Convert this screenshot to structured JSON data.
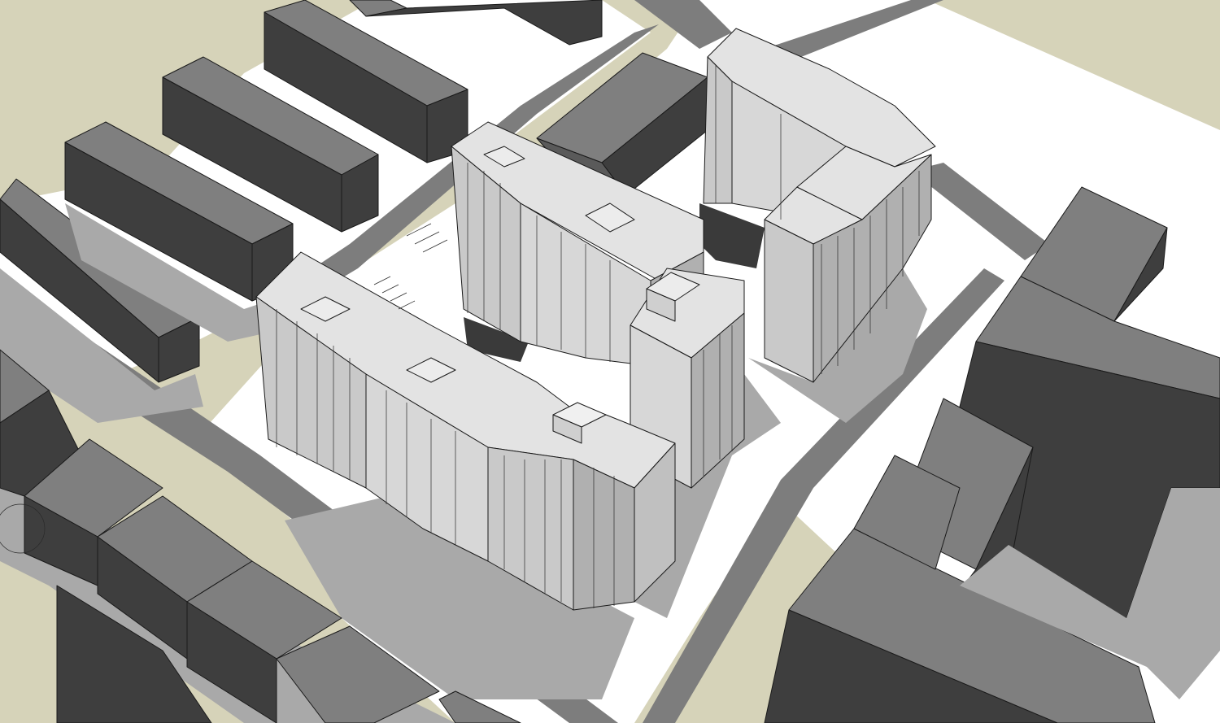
{
  "scene": {
    "description_tag": "massing-model",
    "colors": {
      "ground": "#d6d3b9",
      "site_white": "#ffffff",
      "road": "#7d7d7d",
      "shadow": "#a9a9a9",
      "block_top": "#7f7f7f",
      "block_side": "#3e3e3e",
      "tower_light": "#e3e3e3",
      "tower_mid": "#c9c9c9",
      "tower_dark": "#b0b0b0"
    }
  }
}
